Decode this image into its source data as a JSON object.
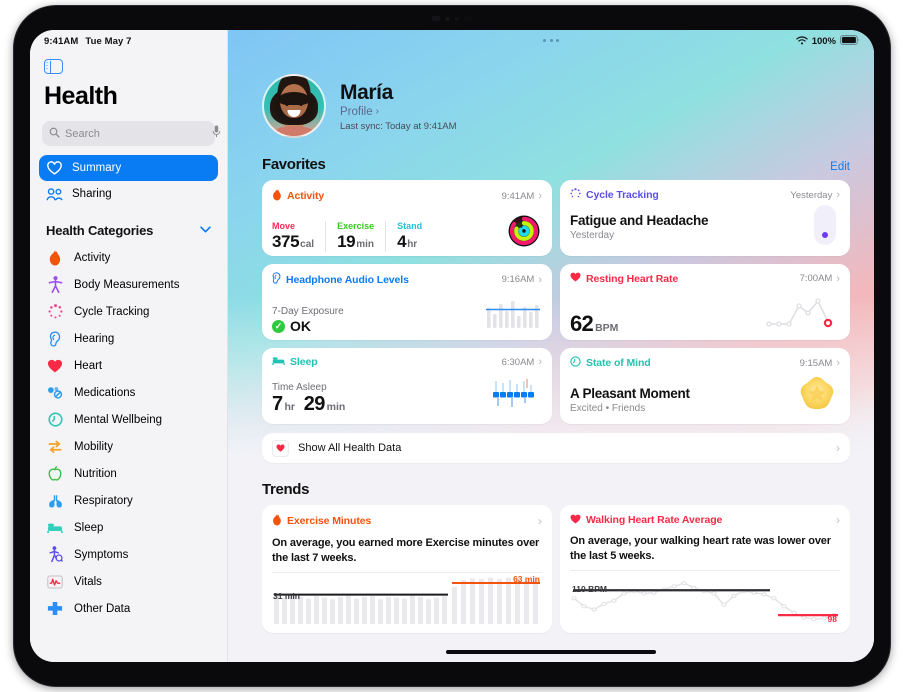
{
  "statusbar": {
    "time": "9:41AM",
    "date": "Tue May 7",
    "battery_pct": "100%",
    "wifi_icon": "wifi-icon",
    "battery_icon": "battery-full-icon"
  },
  "sidebar": {
    "toggle_icon": "sidebar-toggle-icon",
    "title": "Health",
    "search": {
      "placeholder": "Search",
      "value": "",
      "icon": "search-icon",
      "mic_icon": "microphone-icon"
    },
    "nav": [
      {
        "label": "Summary",
        "icon": "heart-outline-icon",
        "active": true
      },
      {
        "label": "Sharing",
        "icon": "people-icon",
        "active": false
      }
    ],
    "categories_header": {
      "label": "Health Categories",
      "chevron": "chevron-down-icon"
    },
    "categories": [
      {
        "label": "Activity",
        "icon": "flame-icon",
        "color": "#f4530d"
      },
      {
        "label": "Body Measurements",
        "icon": "body-icon",
        "color": "#9b4df0"
      },
      {
        "label": "Cycle Tracking",
        "icon": "cycle-icon",
        "color": "#f0408a"
      },
      {
        "label": "Hearing",
        "icon": "ear-icon",
        "color": "#2b8ef5"
      },
      {
        "label": "Heart",
        "icon": "heart-icon",
        "color": "#fa2a46"
      },
      {
        "label": "Medications",
        "icon": "pills-icon",
        "color": "#2b9cf0"
      },
      {
        "label": "Mental Wellbeing",
        "icon": "head-icon",
        "color": "#2ec7b4"
      },
      {
        "label": "Mobility",
        "icon": "mobility-icon",
        "color": "#f5a32a"
      },
      {
        "label": "Nutrition",
        "icon": "apple-icon",
        "color": "#3ac14a"
      },
      {
        "label": "Respiratory",
        "icon": "lungs-icon",
        "color": "#2b9cf0"
      },
      {
        "label": "Sleep",
        "icon": "bed-icon",
        "color": "#32cfbd"
      },
      {
        "label": "Symptoms",
        "icon": "symptoms-icon",
        "color": "#5b4df0"
      },
      {
        "label": "Vitals",
        "icon": "vitals-icon",
        "color": "#fa2a46"
      },
      {
        "label": "Other Data",
        "icon": "plus-icon",
        "color": "#2b8ef5"
      }
    ]
  },
  "profile": {
    "avatar": "user-avatar",
    "name": "María",
    "link_label": "Profile",
    "link_chevron": "chevron-right-icon",
    "last_sync": "Last sync: Today at 9:41AM"
  },
  "favorites": {
    "title": "Favorites",
    "edit_label": "Edit",
    "cards": [
      {
        "id": "activity",
        "title": "Activity",
        "icon": "flame-icon",
        "color": "#f4530d",
        "time": "9:41AM",
        "chevron": "chevron-right-icon",
        "metrics": [
          {
            "label": "Move",
            "value": "375",
            "unit": "cal",
            "color": "#fa2a55"
          },
          {
            "label": "Exercise",
            "value": "19",
            "unit": "min",
            "color": "#52d726"
          },
          {
            "label": "Stand",
            "value": "4",
            "unit": "hr",
            "color": "#2ad8e8"
          }
        ],
        "visual": "activity-rings"
      },
      {
        "id": "cycle-tracking",
        "title": "Cycle Tracking",
        "icon": "cycle-icon",
        "color": "#5b4df0",
        "time": "Yesterday",
        "chevron": "chevron-right-icon",
        "headline": "Fatigue and Headache",
        "subline": "Yesterday",
        "visual": "cycle-dot"
      },
      {
        "id": "headphone-audio-levels",
        "title": "Headphone Audio Levels",
        "icon": "ear-icon",
        "color": "#0a7cf3",
        "time": "9:16AM",
        "chevron": "chevron-right-icon",
        "label": "7-Day Exposure",
        "status": "OK",
        "status_icon": "check-circle-icon",
        "visual": "audio-bars"
      },
      {
        "id": "resting-heart-rate",
        "title": "Resting Heart Rate",
        "icon": "heart-icon",
        "color": "#fa2a46",
        "time": "7:00AM",
        "chevron": "chevron-right-icon",
        "value": "62",
        "unit": "BPM",
        "visual": "hr-sparkline"
      },
      {
        "id": "sleep",
        "title": "Sleep",
        "icon": "bed-icon",
        "color": "#32cfbd",
        "time": "6:30AM",
        "chevron": "chevron-right-icon",
        "label": "Time Asleep",
        "value_h": "7",
        "unit_h": "hr",
        "value_m": "29",
        "unit_m": "min",
        "visual": "sleep-bars"
      },
      {
        "id": "state-of-mind",
        "title": "State of Mind",
        "icon": "head-icon",
        "color": "#2ec7b4",
        "time": "9:15AM",
        "chevron": "chevron-right-icon",
        "headline": "A Pleasant Moment",
        "subline": "Excited • Friends",
        "visual": "mood-star"
      }
    ],
    "show_all": {
      "label": "Show All Health Data",
      "icon": "heart-icon",
      "chevron": "chevron-right-icon"
    }
  },
  "trends": {
    "title": "Trends",
    "cards": [
      {
        "id": "exercise-minutes",
        "title": "Exercise Minutes",
        "icon": "flame-icon",
        "color": "#f4530d",
        "chevron": "chevron-right-icon",
        "description": "On average, you earned more Exercise minutes over the last 7 weeks.",
        "baseline_label": "31 min",
        "current_label": "63 min",
        "current_color": "#f4530d"
      },
      {
        "id": "walking-heart-rate-average",
        "title": "Walking Heart Rate Average",
        "icon": "heart-icon",
        "color": "#fa2a46",
        "chevron": "chevron-right-icon",
        "description": "On average, your walking heart rate was lower over the last 5 weeks.",
        "baseline_label": "110 BPM",
        "current_label": "98",
        "current_color": "#fa2a46"
      }
    ]
  },
  "chart_data": [
    {
      "type": "bar",
      "id": "exercise-minutes-trend",
      "title": "Exercise Minutes",
      "ylabel": "minutes",
      "baseline": 31,
      "baseline_label": "31 min",
      "current": 63,
      "current_label": "63 min",
      "values": [
        30,
        33,
        29,
        31,
        28,
        32,
        30,
        27,
        31,
        33,
        29,
        30,
        32,
        28,
        31,
        30,
        29,
        33,
        31,
        28,
        30,
        32,
        48,
        58,
        62,
        60,
        63,
        61,
        63,
        62,
        59,
        63
      ],
      "baseline_span": [
        0,
        21
      ],
      "current_span": [
        22,
        31
      ],
      "grid": false,
      "legend": "none"
    },
    {
      "type": "line",
      "id": "walking-heart-rate-average-trend",
      "title": "Walking Heart Rate Average",
      "ylabel": "BPM",
      "baseline": 110,
      "baseline_label": "110 BPM",
      "current": 98,
      "current_label": "98",
      "x": [
        0,
        1,
        2,
        3,
        4,
        5,
        6,
        7,
        8,
        9,
        10,
        11,
        12,
        13,
        14,
        15,
        16,
        17,
        18,
        19,
        20,
        21,
        22,
        23,
        24,
        25,
        26
      ],
      "values": [
        108,
        103,
        100,
        104,
        106,
        110,
        112,
        110,
        111,
        113,
        115,
        117,
        114,
        112,
        110,
        104,
        109,
        112,
        111,
        110,
        108,
        104,
        100,
        96,
        95,
        95,
        97
      ],
      "baseline_span": [
        0,
        21
      ],
      "current_span": [
        22,
        26
      ],
      "grid": false,
      "legend": "none"
    }
  ],
  "home_indicator": "home-indicator"
}
